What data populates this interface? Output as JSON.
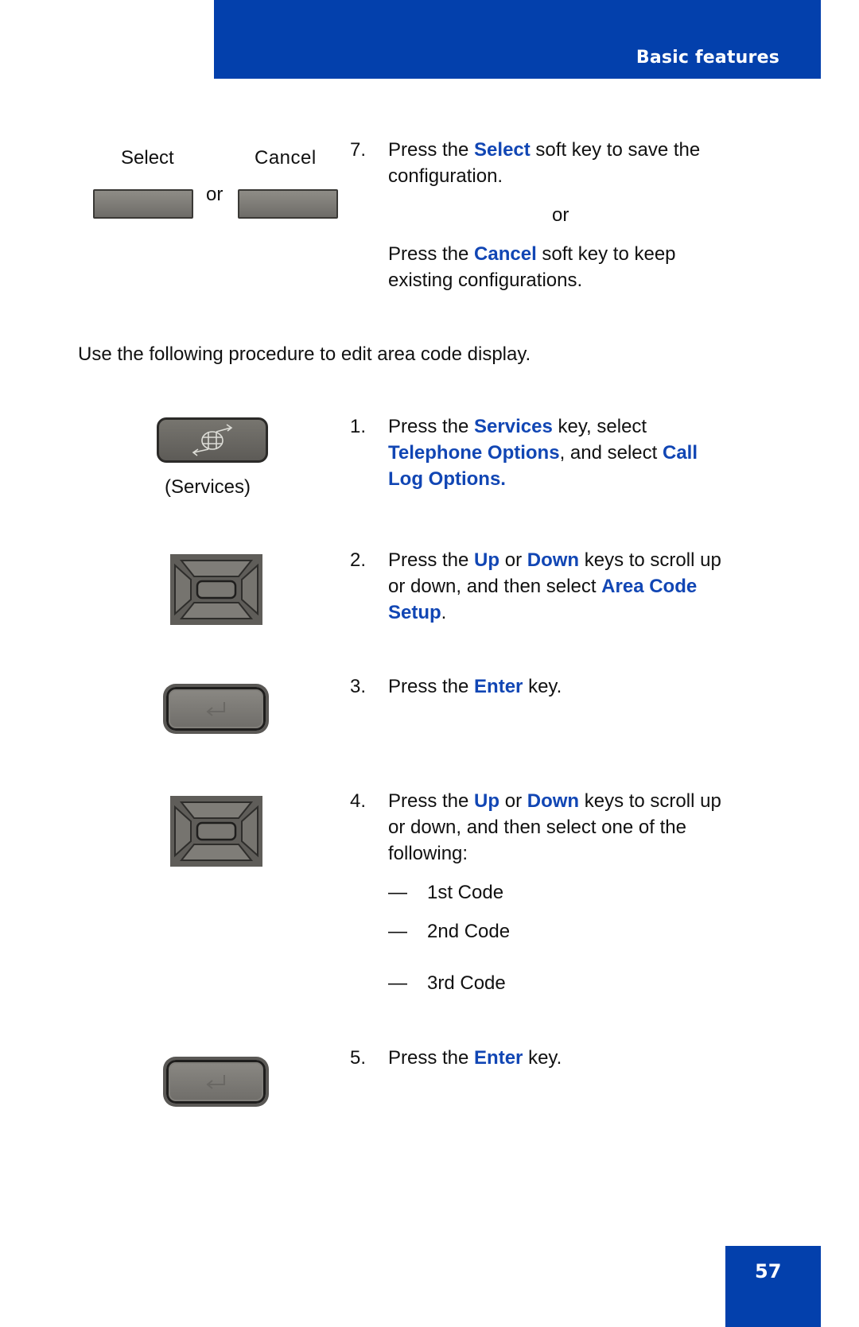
{
  "header": {
    "section_title": "Basic features"
  },
  "footer": {
    "page_number": "57"
  },
  "colors": {
    "brand_blue": "#0340ac",
    "highlight_blue": "#1146b4"
  },
  "softkeys": {
    "select_label": "Select",
    "cancel_label": "Cancel",
    "or_label": "or"
  },
  "step7": {
    "number": "7.",
    "line1_pre": "Press the ",
    "line1_hl": "Select",
    "line1_post": " soft key to save the",
    "line2": "configuration.",
    "or": "or",
    "line3_pre": "Press the ",
    "line3_hl": "Cancel",
    "line3_post": " soft key to keep",
    "line4": "existing configurations."
  },
  "intro": "Use the following procedure to edit area code display.",
  "services_caption": "(Services)",
  "steps": [
    {
      "number": "1.",
      "l1_pre": "Press the ",
      "l1_hl": "Services",
      "l1_post": " key, select",
      "l2_hl": "Telephone Options",
      "l2_mid": ", and select ",
      "l2_hl2": "Call",
      "l3_hl": "Log Options."
    },
    {
      "number": "2.",
      "l1_pre": "Press the ",
      "l1_hl": "Up",
      "l1_mid": " or ",
      "l1_hl2": "Down",
      "l1_post": " keys to scroll up",
      "l2_pre": "or down, and then select ",
      "l2_hl": "Area Code",
      "l3_hl": "Setup",
      "l3_post": "."
    },
    {
      "number": "3.",
      "l1_pre": "Press the ",
      "l1_hl": "Enter",
      "l1_post": " key."
    },
    {
      "number": "4.",
      "l1_pre": "Press the ",
      "l1_hl": "Up",
      "l1_mid": " or ",
      "l1_hl2": "Down",
      "l1_post": " keys to scroll up",
      "l2": "or down, and then select one of the",
      "l3": "following:",
      "options": [
        {
          "dash": "—",
          "label": "1st Code"
        },
        {
          "dash": "—",
          "label": "2nd Code"
        },
        {
          "dash": "—",
          "label": "3rd Code"
        }
      ]
    },
    {
      "number": "5.",
      "l1_pre": "Press the ",
      "l1_hl": "Enter",
      "l1_post": " key."
    }
  ],
  "icons": {
    "softkey": "blank-softkey",
    "services": "globe-arrows-icon",
    "navigation": "nav-cluster-icon",
    "enter": "enter-key-icon"
  }
}
